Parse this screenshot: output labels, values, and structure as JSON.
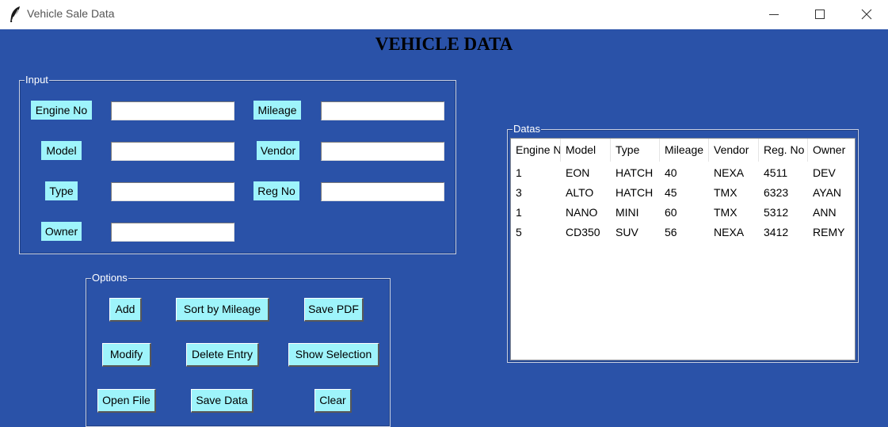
{
  "window": {
    "title": "Vehicle Sale Data"
  },
  "app": {
    "heading": "VEHICLE DATA"
  },
  "input": {
    "frame_label": "Input",
    "labels": {
      "engine_no": "Engine No",
      "mileage": "Mileage",
      "model": "Model",
      "vendor": "Vendor",
      "type": "Type",
      "reg_no": "Reg No",
      "owner": "Owner"
    },
    "values": {
      "engine_no": "",
      "mileage": "",
      "model": "",
      "vendor": "",
      "type": "",
      "reg_no": "",
      "owner": ""
    }
  },
  "options": {
    "frame_label": "Options",
    "buttons": {
      "add": "Add",
      "sort": "Sort by Mileage",
      "save_pdf": "Save PDF",
      "modify": "Modify",
      "delete": "Delete Entry",
      "show_selection": "Show Selection",
      "open_file": "Open File",
      "save_data": "Save Data",
      "clear": "Clear"
    }
  },
  "datas": {
    "frame_label": "Datas",
    "columns": [
      "Engine No",
      "Model",
      "Type",
      "Mileage",
      "Vendor",
      "Reg. No",
      "Owner"
    ],
    "rows": [
      [
        "1",
        "EON",
        "HATCH",
        "40",
        "NEXA",
        "4511",
        "DEV"
      ],
      [
        "3",
        "ALTO",
        "HATCH",
        "45",
        "TMX",
        "6323",
        "AYAN"
      ],
      [
        "1",
        "NANO",
        "MINI",
        "60",
        "TMX",
        "5312",
        "ANN"
      ],
      [
        "5",
        "CD350",
        "SUV",
        "56",
        "NEXA",
        "3412",
        "REMY"
      ]
    ]
  },
  "colors": {
    "background": "#2a52a8",
    "label_bg": "#9ef4fb"
  },
  "icons": {
    "app": "feather-icon",
    "minimize": "minimize-icon",
    "maximize": "maximize-icon",
    "close": "close-icon"
  }
}
